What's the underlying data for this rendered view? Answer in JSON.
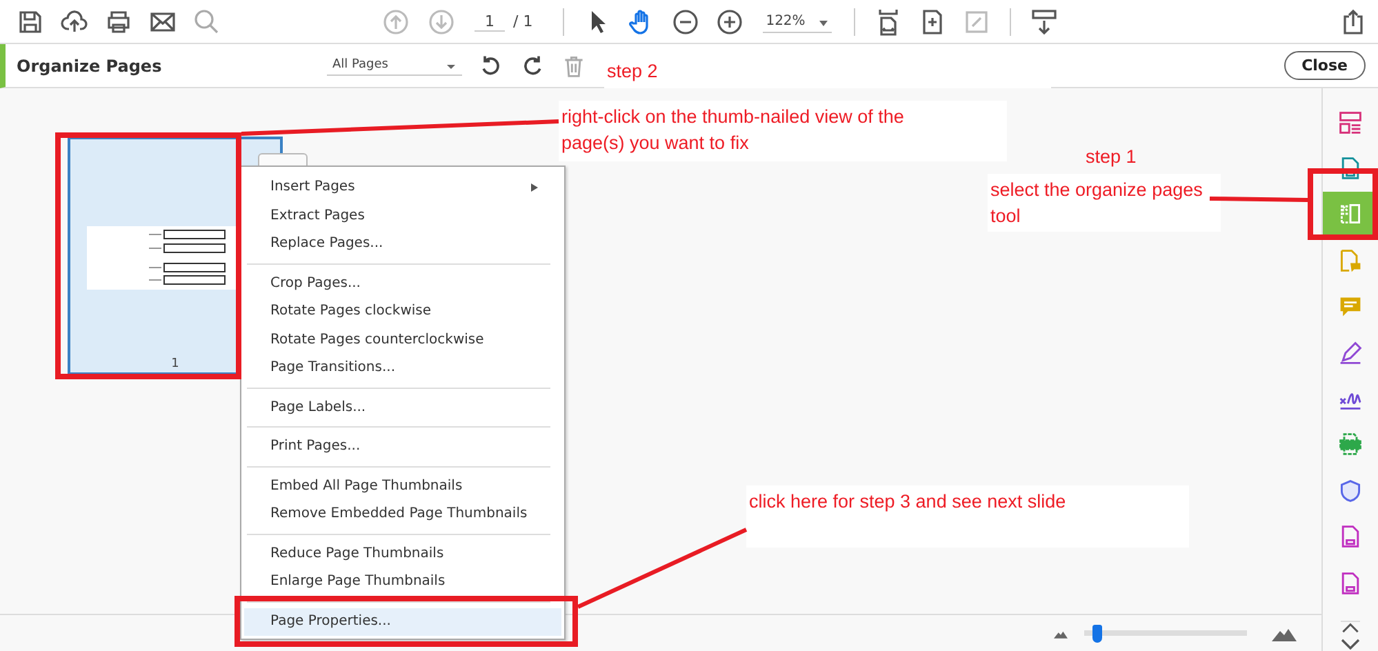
{
  "toolbar": {
    "page_number": "1",
    "page_total": "/ 1",
    "zoom": "122%"
  },
  "organize_bar": {
    "title": "Organize Pages",
    "page_filter": "All Pages",
    "close": "Close"
  },
  "thumbnail": {
    "label": "1",
    "selected": true
  },
  "context_menu": {
    "groups": [
      [
        {
          "label": "Insert Pages",
          "submenu": true,
          "selected": false
        },
        {
          "label": "Extract Pages",
          "submenu": false,
          "selected": false
        },
        {
          "label": "Replace Pages...",
          "submenu": false,
          "selected": false
        }
      ],
      [
        {
          "label": "Crop Pages...",
          "submenu": false,
          "selected": false
        },
        {
          "label": "Rotate Pages clockwise",
          "submenu": false,
          "selected": false
        },
        {
          "label": "Rotate Pages counterclockwise",
          "submenu": false,
          "selected": false
        },
        {
          "label": "Page Transitions...",
          "submenu": false,
          "selected": false
        }
      ],
      [
        {
          "label": "Page Labels...",
          "submenu": false,
          "selected": false
        }
      ],
      [
        {
          "label": "Print Pages...",
          "submenu": false,
          "selected": false
        }
      ],
      [
        {
          "label": "Embed All Page Thumbnails",
          "submenu": false,
          "selected": false
        },
        {
          "label": "Remove Embedded Page Thumbnails",
          "submenu": false,
          "selected": false
        }
      ],
      [
        {
          "label": "Reduce Page Thumbnails",
          "submenu": false,
          "selected": false
        },
        {
          "label": "Enlarge Page Thumbnails",
          "submenu": false,
          "selected": false
        }
      ],
      [
        {
          "label": "Page Properties...",
          "submenu": false,
          "selected": true
        }
      ]
    ]
  },
  "tools": [
    {
      "kind": "layout",
      "color": "#d7317a",
      "selected": false
    },
    {
      "kind": "document",
      "color": "#14919b",
      "selected": false
    },
    {
      "kind": "organize",
      "color": "#ffffff",
      "selected": true
    },
    {
      "kind": "comment-doc",
      "color": "#d9a800",
      "selected": false
    },
    {
      "kind": "comment",
      "color": "#d9a800",
      "selected": false
    },
    {
      "kind": "pen",
      "color": "#9049d4",
      "selected": false
    },
    {
      "kind": "sign",
      "color": "#6e4ad6",
      "selected": false
    },
    {
      "kind": "printer",
      "color": "#2da84a",
      "selected": false
    },
    {
      "kind": "shield",
      "color": "#5866e8",
      "selected": false
    },
    {
      "kind": "document",
      "color": "#c02fc0",
      "selected": false
    },
    {
      "kind": "document",
      "color": "#c02fc0",
      "selected": false
    }
  ],
  "thumbnail_size": {
    "level": 0.05
  },
  "annotations": [
    {
      "kind": "step",
      "text": "step 2"
    },
    {
      "kind": "note",
      "text": "right-click on the thumb-nailed view of the page(s) you want to fix"
    },
    {
      "kind": "step",
      "text": "step 1"
    },
    {
      "kind": "note",
      "text": "select the organize pages tool"
    },
    {
      "kind": "note",
      "text": "click here for step 3 and see next slide"
    }
  ]
}
